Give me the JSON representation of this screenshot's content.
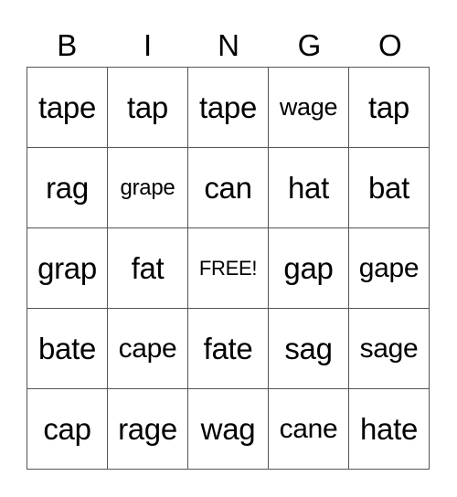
{
  "header": [
    "B",
    "I",
    "N",
    "G",
    "O"
  ],
  "rows": [
    [
      "tape",
      "tap",
      "tape",
      "wage",
      "tap"
    ],
    [
      "rag",
      "grape",
      "can",
      "hat",
      "bat"
    ],
    [
      "grap",
      "fat",
      "FREE!",
      "gap",
      "gape"
    ],
    [
      "bate",
      "cape",
      "fate",
      "sag",
      "sage"
    ],
    [
      "cap",
      "rage",
      "wag",
      "cane",
      "hate"
    ]
  ]
}
